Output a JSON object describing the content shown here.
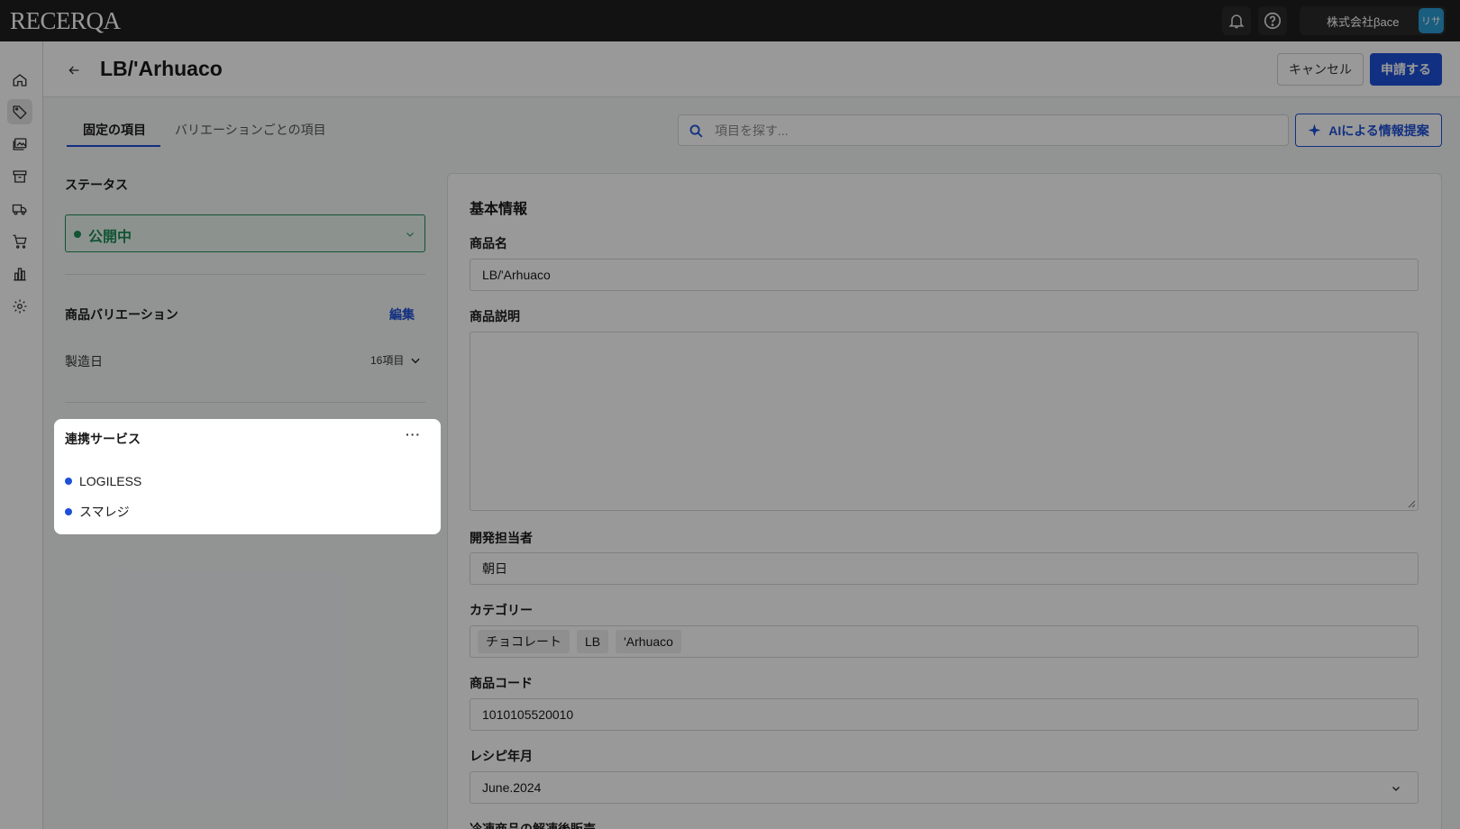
{
  "app": {
    "logo": "RECERQA"
  },
  "topbar": {
    "company": "株式会社βace",
    "avatar": "リサ"
  },
  "sidebar": {
    "items": [
      {
        "icon": "home-icon"
      },
      {
        "icon": "tag-icon",
        "active": true
      },
      {
        "icon": "images-icon"
      },
      {
        "icon": "archive-icon"
      },
      {
        "icon": "truck-icon"
      },
      {
        "icon": "cart-icon"
      },
      {
        "icon": "chart-icon"
      },
      {
        "icon": "gear-icon"
      }
    ]
  },
  "header": {
    "title": "LB/'Arhuaco",
    "cancel_label": "キャンセル",
    "apply_label": "申請する"
  },
  "tabs": {
    "fixed": "固定の項目",
    "variation": "バリエーションごとの項目"
  },
  "search": {
    "placeholder": "項目を探す..."
  },
  "ai_button": {
    "label": "AIによる情報提案"
  },
  "status": {
    "title": "ステータス",
    "value": "公開中",
    "color": "#1e8c57"
  },
  "variations": {
    "title": "商品バリエーション",
    "edit_label": "編集",
    "item_name": "製造日",
    "item_count": "16項目"
  },
  "services": {
    "title": "連携サービス",
    "more": "···",
    "items": [
      "LOGILESS",
      "スマレジ"
    ]
  },
  "basic_info": {
    "title": "基本情報",
    "product_name_label": "商品名",
    "product_name": "LB/'Arhuaco",
    "description_label": "商品説明",
    "description": "",
    "developer_label": "開発担当者",
    "developer": "朝日",
    "category_label": "カテゴリー",
    "categories": [
      "チョコレート",
      "LB",
      "'Arhuaco"
    ],
    "code_label": "商品コード",
    "code": "1010105520010",
    "recipe_label": "レシピ年月",
    "recipe": "June.2024",
    "frozen_label": "冷凍商品の解凍後販売"
  },
  "colors": {
    "accent": "#1e50d8",
    "topbar": "#1f1f1f"
  }
}
